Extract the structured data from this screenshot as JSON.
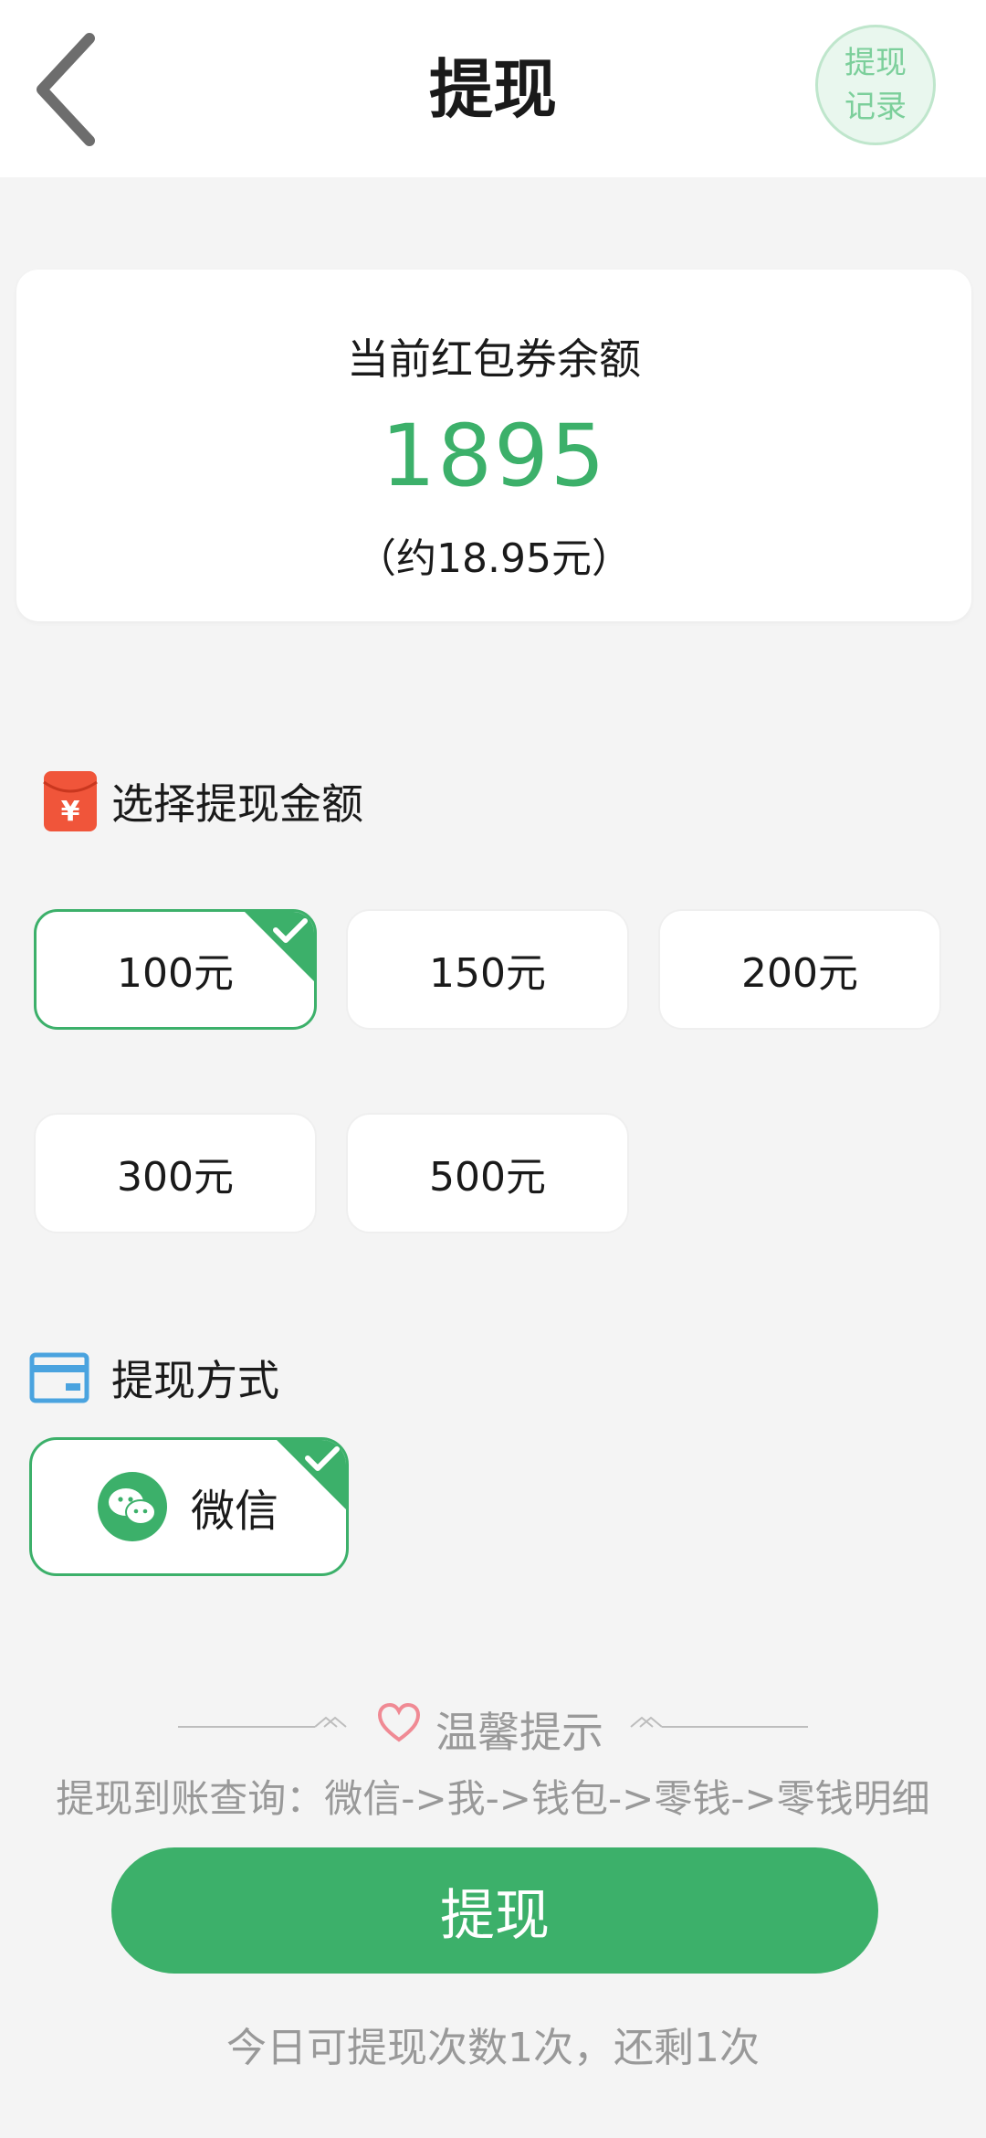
{
  "header": {
    "title": "提现",
    "record_line1": "提现",
    "record_line2": "记录"
  },
  "balance": {
    "label": "当前红包券余额",
    "value": "1895",
    "approx": "（约18.95元）"
  },
  "amount_section": {
    "title": "选择提现金额",
    "options": [
      {
        "label": "100元",
        "selected": true
      },
      {
        "label": "150元",
        "selected": false
      },
      {
        "label": "200元",
        "selected": false
      },
      {
        "label": "300元",
        "selected": false
      },
      {
        "label": "500元",
        "selected": false
      }
    ]
  },
  "method_section": {
    "title": "提现方式",
    "option": {
      "label": "微信",
      "selected": true
    }
  },
  "tips": {
    "title": "温馨提示",
    "text": "提现到账查询：微信->我->钱包->零钱->零钱明细"
  },
  "action": {
    "button_label": "提现",
    "remaining_text": "今日可提现次数1次，还剩1次"
  },
  "colors": {
    "accent": "#3cb06a",
    "icon_red": "#f0553a",
    "icon_blue": "#4aa3df"
  }
}
